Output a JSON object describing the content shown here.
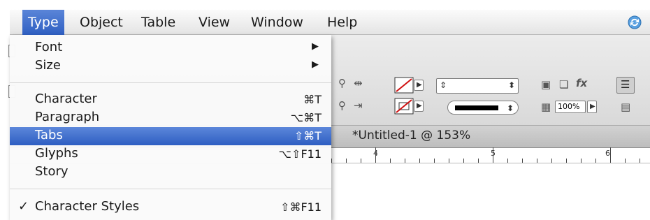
{
  "menubar": {
    "items": [
      "Type",
      "Object",
      "Table",
      "View",
      "Window",
      "Help"
    ],
    "active": "Type"
  },
  "document": {
    "title": "*Untitled-1 @ 153%"
  },
  "toolbar": {
    "zoom_value": "100%"
  },
  "ruler": {
    "numbers": [
      "4",
      "5",
      "6"
    ]
  },
  "type_menu": {
    "items": [
      {
        "label": "Font",
        "shortcut": "",
        "submenu": true
      },
      {
        "label": "Size",
        "shortcut": "",
        "submenu": true
      },
      {
        "label": "Character",
        "shortcut": "⌘T"
      },
      {
        "label": "Paragraph",
        "shortcut": "⌥⌘T"
      },
      {
        "label": "Tabs",
        "shortcut": "⇧⌘T",
        "highlighted": true
      },
      {
        "label": "Glyphs",
        "shortcut": "⌥⇧F11"
      },
      {
        "label": "Story",
        "shortcut": ""
      },
      {
        "label": "Character Styles",
        "shortcut": "⇧⌘F11",
        "checked": true
      }
    ],
    "submenu_arrow": "▶",
    "check_mark": "✓"
  },
  "colors": {
    "highlight": "#2f5fc2",
    "menubar_bg": "#ececec"
  }
}
